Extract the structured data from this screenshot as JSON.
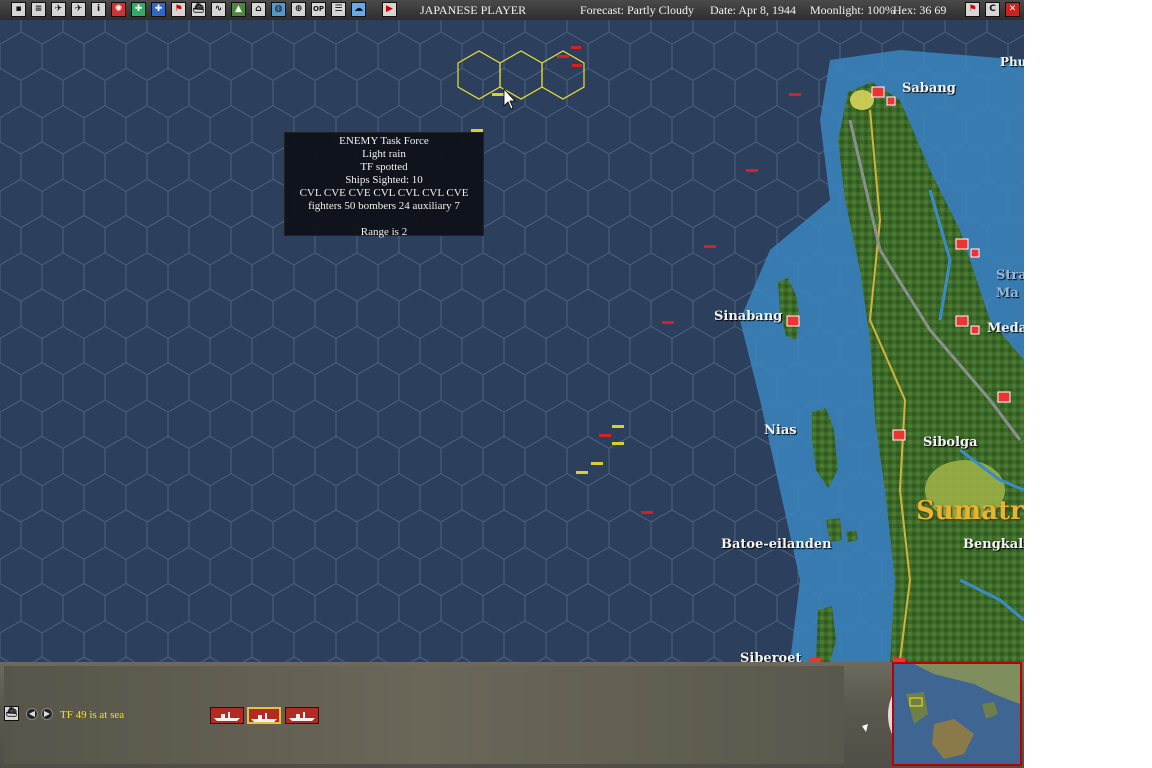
{
  "toolbar": {
    "icons": [
      "save-icon",
      "report-icon",
      "aircraft-icon",
      "aircraft-icon",
      "unit-icon",
      "info-icon",
      "rising-sun-icon",
      "ground-unit-icon",
      "plane-icon",
      "flag-icon",
      "ship-icon",
      "scroll-icon",
      "supply-icon",
      "base-icon",
      "globe-icon",
      "zoom-icon",
      "op-icon",
      "list-icon",
      "cloud-icon",
      "play-icon"
    ],
    "player": "JAPANESE PLAYER",
    "forecast": "Forecast: Partly Cloudy",
    "date": "Date: Apr 8, 1944",
    "moonlight": "Moonlight: 100%",
    "hex": "Hex: 36 69",
    "right_icons": [
      "flag-icon",
      "c-icon",
      "close-icon"
    ],
    "right_labels": [
      "",
      "C",
      "✕"
    ]
  },
  "map": {
    "places": {
      "sabang": "Sabang",
      "phu": "Phu",
      "sinabang": "Sinabang",
      "nias": "Nias",
      "sibolga": "Sibolga",
      "medan": "Medan",
      "sumatra": "Sumatra",
      "bengkalis": "Bengkalis",
      "batoe": "Batoe-eilanden",
      "siberoet": "Siberoet",
      "strait": "Stra",
      "strait2": "Ma"
    }
  },
  "tooltip": {
    "line1": "ENEMY Task Force",
    "line2": "Light rain",
    "line3": "TF spotted",
    "line4": "Ships Sighted: 10",
    "line5": "CVL CVE CVE CVL CVL CVL CVE",
    "line6": "fighters 50  bombers 24  auxiliary 7",
    "line7": "",
    "line8": "Range is 2"
  },
  "panel": {
    "status": "TF 49 is at sea"
  },
  "colors": {
    "sea": "#2a3d5a",
    "land": "#3f6a2a",
    "enemy": "#d22",
    "friendly": "#e8e030"
  }
}
